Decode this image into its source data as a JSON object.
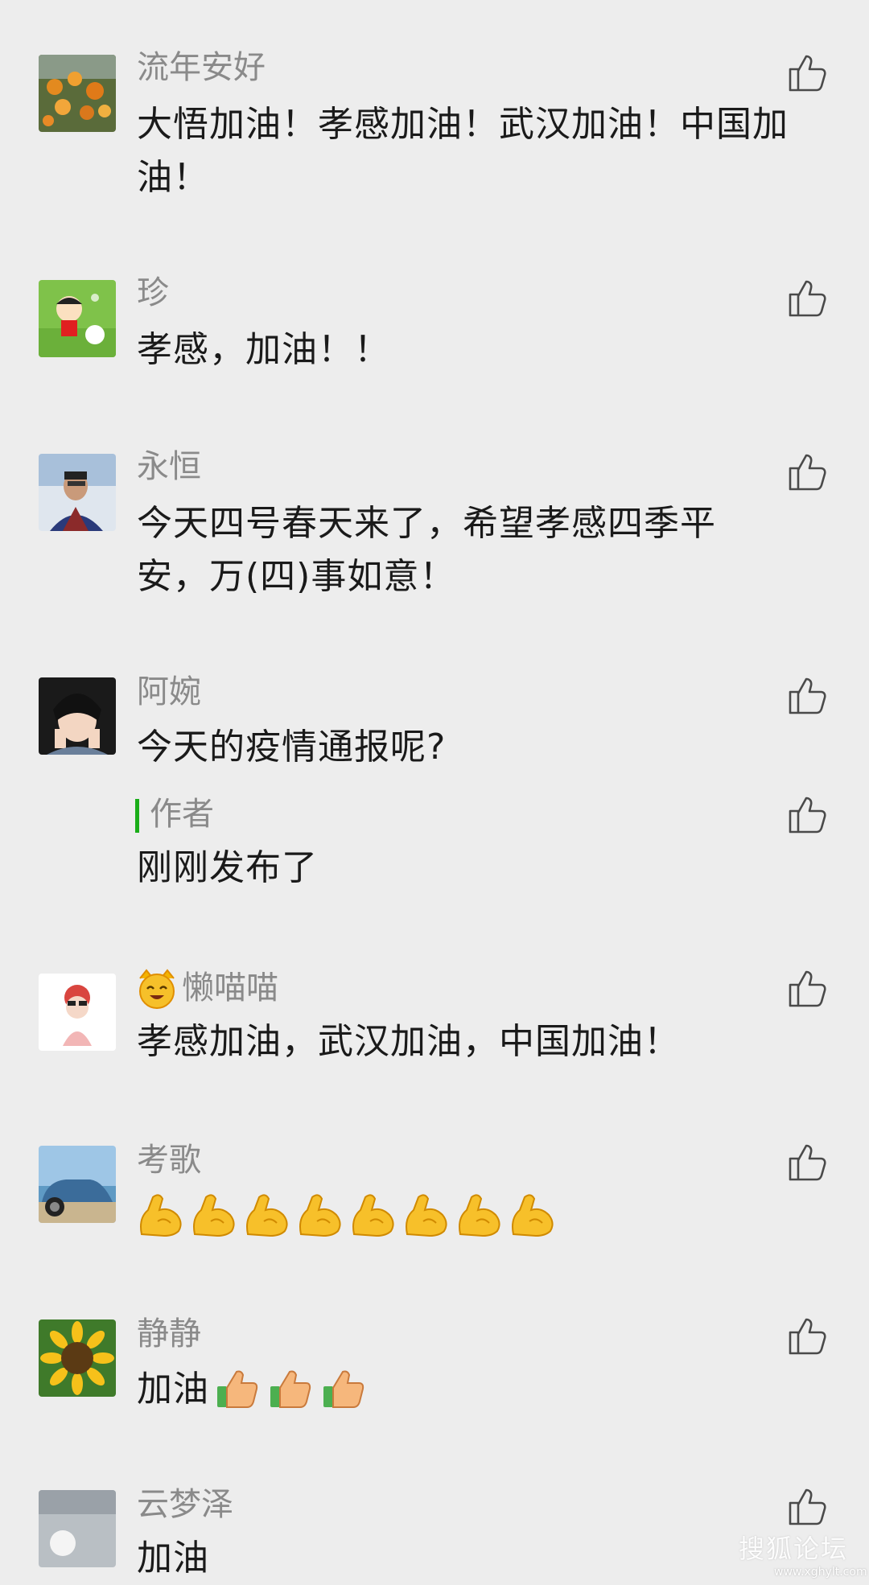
{
  "comments": [
    {
      "name": "流年安好",
      "text": "大悟加油！孝感加油！武汉加油！中国加油！"
    },
    {
      "name": "珍",
      "text": "孝感，加油！！"
    },
    {
      "name": "永恒",
      "text": "今天四号春天来了，希望孝感四季平安，万(四)事如意！"
    },
    {
      "name": "阿婉",
      "text": "今天的疫情通报呢?",
      "reply": {
        "name": "作者",
        "text": "刚刚发布了"
      }
    },
    {
      "name": "懒喵喵",
      "text": "孝感加油，武汉加油，中国加油！"
    },
    {
      "name": "考歌",
      "text": ""
    },
    {
      "name": "静静",
      "text": "加油"
    },
    {
      "name": "云梦泽",
      "text": "加油"
    }
  ],
  "icons": {
    "like": "thumbs-up-outline-icon",
    "muscle": "flexed-biceps-emoji",
    "thumb": "thumbs-up-emoji",
    "cat": "cat-face-emoji"
  },
  "colors": {
    "background": "#ededed",
    "name": "#8a8a8a",
    "text": "#1a1a1a",
    "author_accent": "#1aad19"
  },
  "watermark": {
    "text": "搜狐论坛",
    "url": "www.xghylt.com"
  }
}
